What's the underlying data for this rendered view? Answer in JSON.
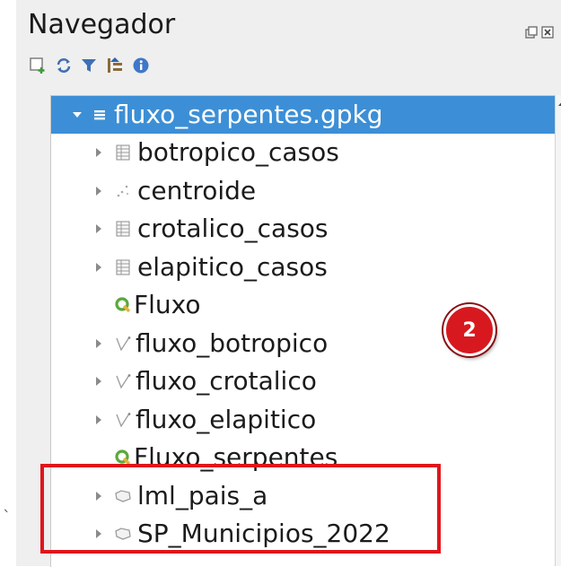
{
  "panel": {
    "title": "Navegador"
  },
  "window_buttons": [
    "restore-icon",
    "close-icon"
  ],
  "toolbar": {
    "icons": [
      "add-layer-icon",
      "refresh-icon",
      "filter-icon",
      "collapse-all-icon",
      "properties-icon"
    ]
  },
  "tree": {
    "items": [
      {
        "label": "fluxo_serpentes.gpkg",
        "icon": "database-icon",
        "expanded": true,
        "selected": true
      },
      {
        "label": "botropico_casos",
        "icon": "table-icon"
      },
      {
        "label": "centroide",
        "icon": "point-layer-icon"
      },
      {
        "label": "crotalico_casos",
        "icon": "table-icon"
      },
      {
        "label": "elapitico_casos",
        "icon": "table-icon"
      },
      {
        "label": "Fluxo",
        "icon": "qgis-project-icon"
      },
      {
        "label": "fluxo_botropico",
        "icon": "line-layer-icon"
      },
      {
        "label": "fluxo_crotalico",
        "icon": "line-layer-icon"
      },
      {
        "label": "fluxo_elapitico",
        "icon": "line-layer-icon"
      },
      {
        "label": "Fluxo_serpentes",
        "icon": "qgis-project-icon"
      },
      {
        "label": "lml_pais_a",
        "icon": "polygon-layer-icon"
      },
      {
        "label": "SP_Municipios_2022",
        "icon": "polygon-layer-icon"
      }
    ]
  },
  "annotation": {
    "badge_label": "2",
    "colors": {
      "badge": "#d7191f",
      "box": "#e0151b",
      "selection": "#3c8fd6"
    }
  },
  "stray_mark": "`"
}
